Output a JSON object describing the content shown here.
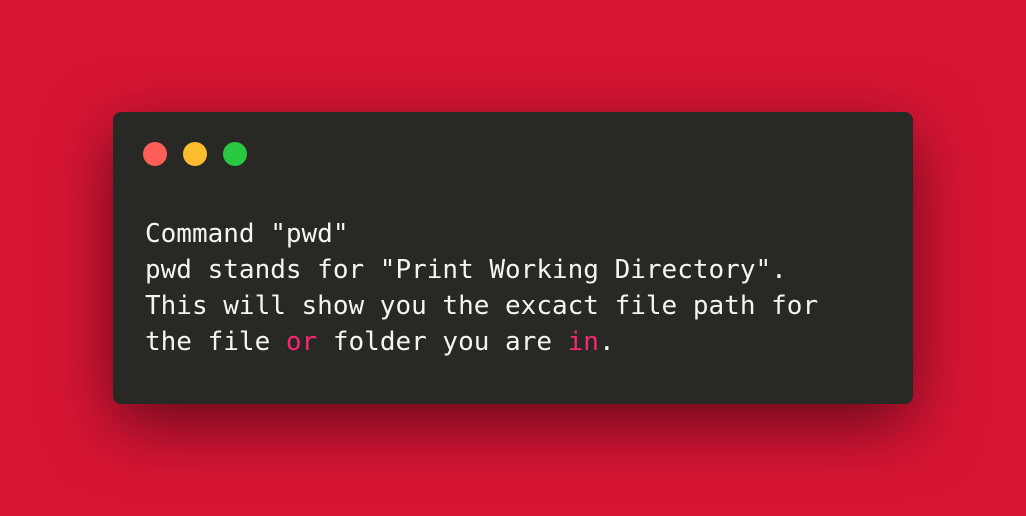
{
  "window": {
    "buttons": [
      {
        "name": "close",
        "color": "#ff5f57"
      },
      {
        "name": "minimize",
        "color": "#febc2e"
      },
      {
        "name": "maximize",
        "color": "#28c840"
      }
    ]
  },
  "code": {
    "line1": "Command \"pwd\"",
    "line2": "pwd stands for \"Print Working Directory\".",
    "line3": "This will show you the excact file path for",
    "line4_prefix": "the file ",
    "line4_kw1": "or",
    "line4_mid": " folder you are ",
    "line4_kw2": "in",
    "line4_suffix": ".",
    "keyword_color": "#f92672",
    "text_color": "#f4f4f0"
  },
  "colors": {
    "background": "#d91535",
    "window_background": "#282824"
  }
}
